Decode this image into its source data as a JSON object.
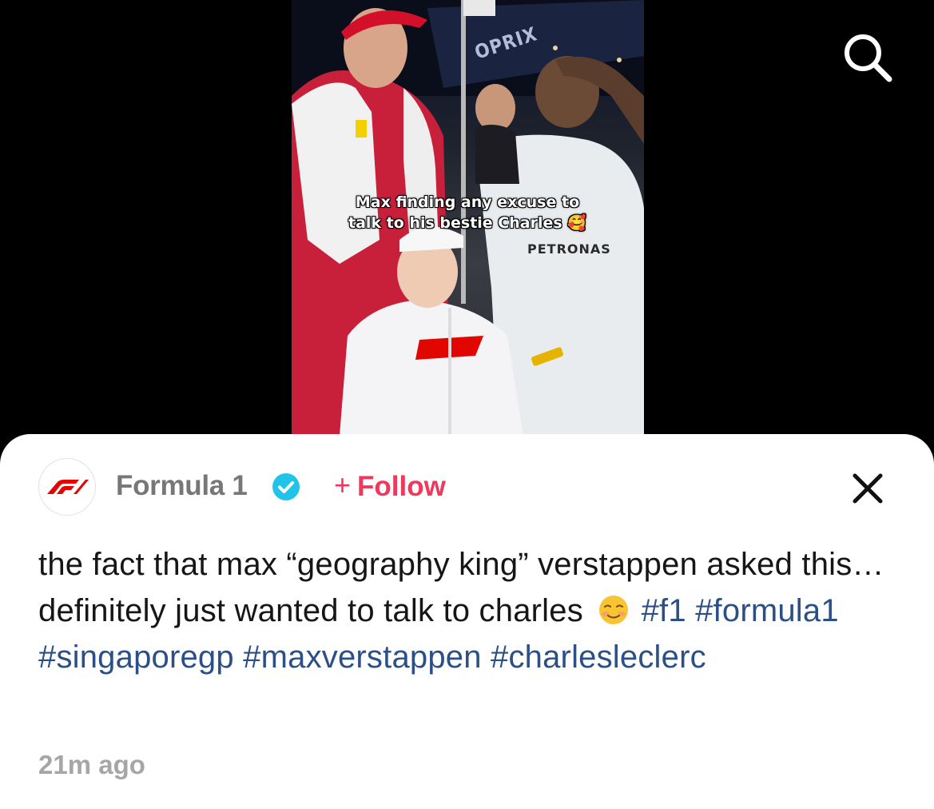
{
  "video": {
    "caption_line1": "Max finding any excuse to",
    "caption_line2": "talk to his bestie Charles 🥰",
    "banner_text": "OPRIX",
    "shirt_text": "PETRONAS"
  },
  "header": {
    "search_icon": "search-icon"
  },
  "post": {
    "account_name": "Formula 1",
    "verified_icon": "verified-badge-icon",
    "follow_plus": "+",
    "follow_label": "Follow",
    "close_icon": "close-icon",
    "description_text": "the fact that max “geography king” verstappen asked this… definitely just wanted to talk to charles",
    "emoji": "smiling-face-icon",
    "hashtags": [
      "#f1",
      "#formula1",
      "#singaporegp",
      "#maxverstappen",
      "#charlesleclerc"
    ],
    "timestamp": "21m ago"
  },
  "colors": {
    "follow": "#f2375c",
    "hashtag": "#2b4f86",
    "verified": "#20c4e8",
    "f1_red": "#e10600"
  }
}
